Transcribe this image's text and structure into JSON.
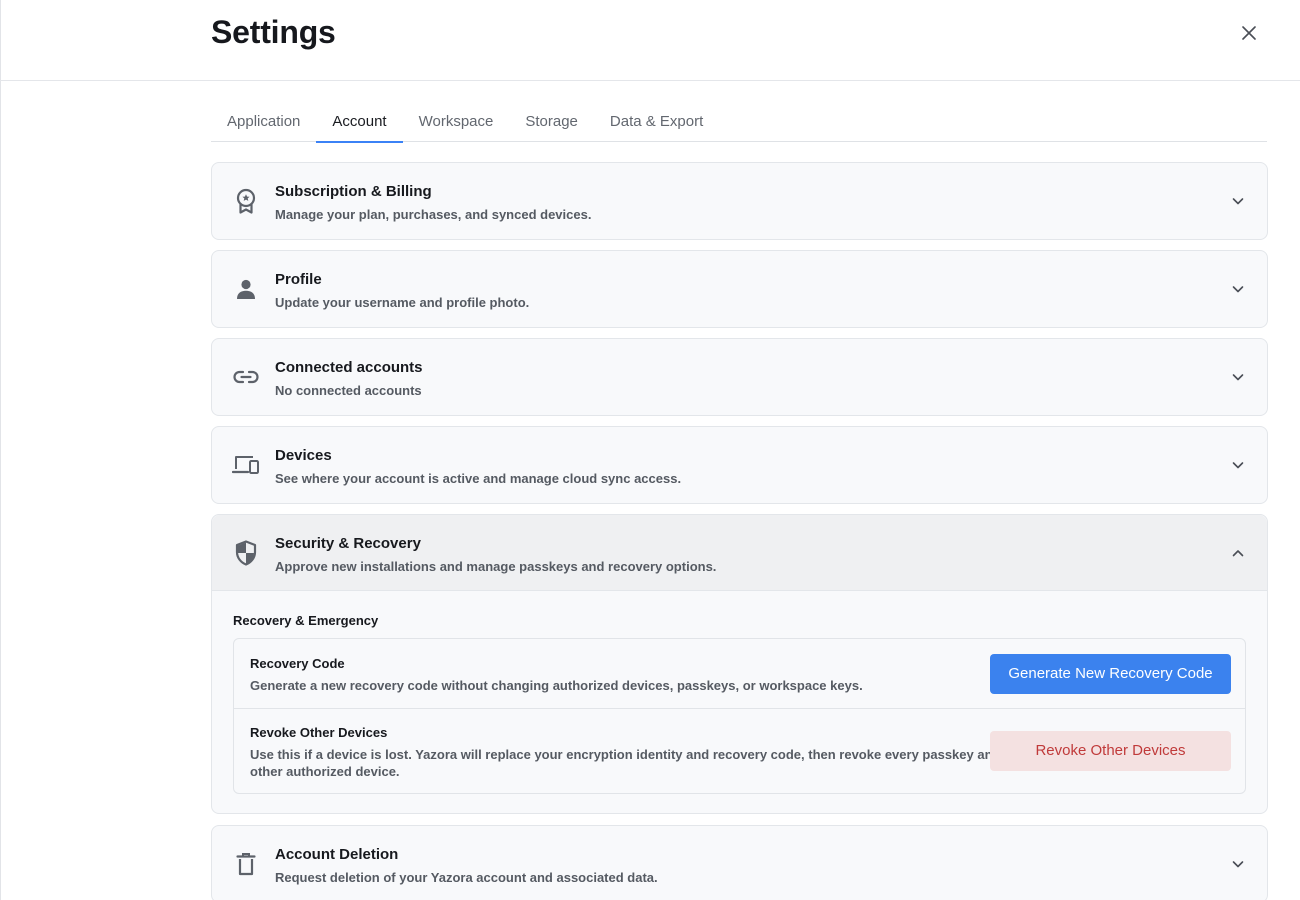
{
  "header": {
    "title": "Settings"
  },
  "tabs": [
    {
      "label": "Application"
    },
    {
      "label": "Account",
      "active": true
    },
    {
      "label": "Workspace"
    },
    {
      "label": "Storage"
    },
    {
      "label": "Data & Export"
    }
  ],
  "sections": {
    "subscription": {
      "title": "Subscription & Billing",
      "subtitle": "Manage your plan, purchases, and synced devices.",
      "icon": "award-badge-icon"
    },
    "profile": {
      "title": "Profile",
      "subtitle": "Update your username and profile photo.",
      "icon": "person-icon"
    },
    "connected": {
      "title": "Connected accounts",
      "subtitle": "No connected accounts",
      "icon": "link-icon"
    },
    "devices": {
      "title": "Devices",
      "subtitle": "See where your account is active and manage cloud sync access.",
      "icon": "devices-icon"
    },
    "security": {
      "title": "Security & Recovery",
      "subtitle": "Approve new installations and manage passkeys and recovery options.",
      "icon": "shield-icon",
      "expanded": true,
      "group_title": "Recovery & Emergency",
      "recovery_code": {
        "title": "Recovery Code",
        "description": "Generate a new recovery code without changing authorized devices, passkeys, or workspace keys.",
        "button": "Generate New Recovery Code"
      },
      "revoke": {
        "title": "Revoke Other Devices",
        "description_line1": "Use this if a device is lost. Yazora will replace your encryption identity and recovery code, then revoke every passkey and",
        "description_line2": "other authorized device.",
        "button": "Revoke Other Devices"
      }
    },
    "deletion": {
      "title": "Account Deletion",
      "subtitle": "Request deletion of your Yazora account and associated data.",
      "icon": "trash-icon"
    }
  },
  "colors": {
    "accent": "#3b82ee",
    "danger_text": "#c03a3a",
    "danger_bg": "#f4e1e1"
  }
}
